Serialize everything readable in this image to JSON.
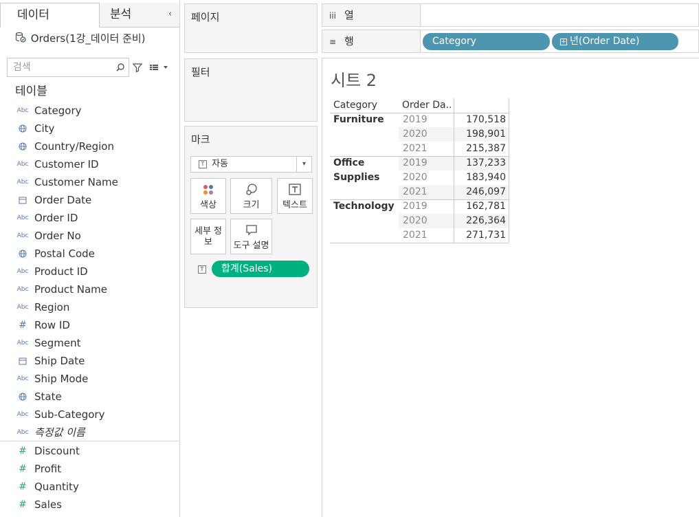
{
  "left_pane": {
    "tabs": {
      "data": "데이터",
      "analysis": "분석"
    },
    "datasource": "Orders(1강_데이터 준비)",
    "search": {
      "placeholder": "검색",
      "value": ""
    },
    "section_label": "테이블",
    "fields": [
      {
        "label": "Category",
        "icon": "abc-icon"
      },
      {
        "label": "City",
        "icon": "globe-icon"
      },
      {
        "label": "Country/Region",
        "icon": "globe-icon"
      },
      {
        "label": "Customer ID",
        "icon": "abc-icon"
      },
      {
        "label": "Customer Name",
        "icon": "abc-icon"
      },
      {
        "label": "Order Date",
        "icon": "calendar-icon"
      },
      {
        "label": "Order ID",
        "icon": "abc-icon"
      },
      {
        "label": "Order No",
        "icon": "abc-icon"
      },
      {
        "label": "Postal Code",
        "icon": "globe-icon"
      },
      {
        "label": "Product ID",
        "icon": "abc-icon"
      },
      {
        "label": "Product Name",
        "icon": "abc-icon"
      },
      {
        "label": "Region",
        "icon": "abc-icon"
      },
      {
        "label": "Row ID",
        "icon": "hash-icon"
      },
      {
        "label": "Segment",
        "icon": "abc-icon"
      },
      {
        "label": "Ship Date",
        "icon": "calendar-icon"
      },
      {
        "label": "Ship Mode",
        "icon": "abc-icon"
      },
      {
        "label": "State",
        "icon": "globe-icon"
      },
      {
        "label": "Sub-Category",
        "icon": "abc-icon"
      },
      {
        "label": "측정값 이름",
        "icon": "abc-icon"
      }
    ],
    "measures": [
      {
        "label": "Discount",
        "icon": "hash-icon"
      },
      {
        "label": "Profit",
        "icon": "hash-icon"
      },
      {
        "label": "Quantity",
        "icon": "hash-icon"
      },
      {
        "label": "Sales",
        "icon": "hash-icon"
      }
    ]
  },
  "cards": {
    "pages": "페이지",
    "filters": "필터",
    "marks": {
      "title": "마크",
      "mark_type": "자동",
      "color": "색상",
      "size": "크기",
      "label": "텍스트",
      "detail": "세부 정보",
      "tooltip": "도구 설명",
      "pill": "합계(Sales)"
    }
  },
  "shelves": {
    "columns": "열",
    "rows": "행",
    "row_pills": [
      "Category",
      "년(Order Date)"
    ]
  },
  "view": {
    "sheet_title": "시트 2",
    "headers": {
      "category": "Category",
      "year": "Order Da.."
    },
    "colors": {
      "dimension_pill": "#4e95b0",
      "measure_pill": "#00b180"
    },
    "table": [
      {
        "category": "Furniture",
        "rows": [
          {
            "year": "2019",
            "value": "170,518"
          },
          {
            "year": "2020",
            "value": "198,901"
          },
          {
            "year": "2021",
            "value": "215,387"
          }
        ]
      },
      {
        "category": "Office Supplies",
        "rows": [
          {
            "year": "2019",
            "value": "137,233"
          },
          {
            "year": "2020",
            "value": "183,940"
          },
          {
            "year": "2021",
            "value": "246,097"
          }
        ]
      },
      {
        "category": "Technology",
        "rows": [
          {
            "year": "2019",
            "value": "162,781"
          },
          {
            "year": "2020",
            "value": "226,364"
          },
          {
            "year": "2021",
            "value": "271,731"
          }
        ]
      }
    ]
  }
}
